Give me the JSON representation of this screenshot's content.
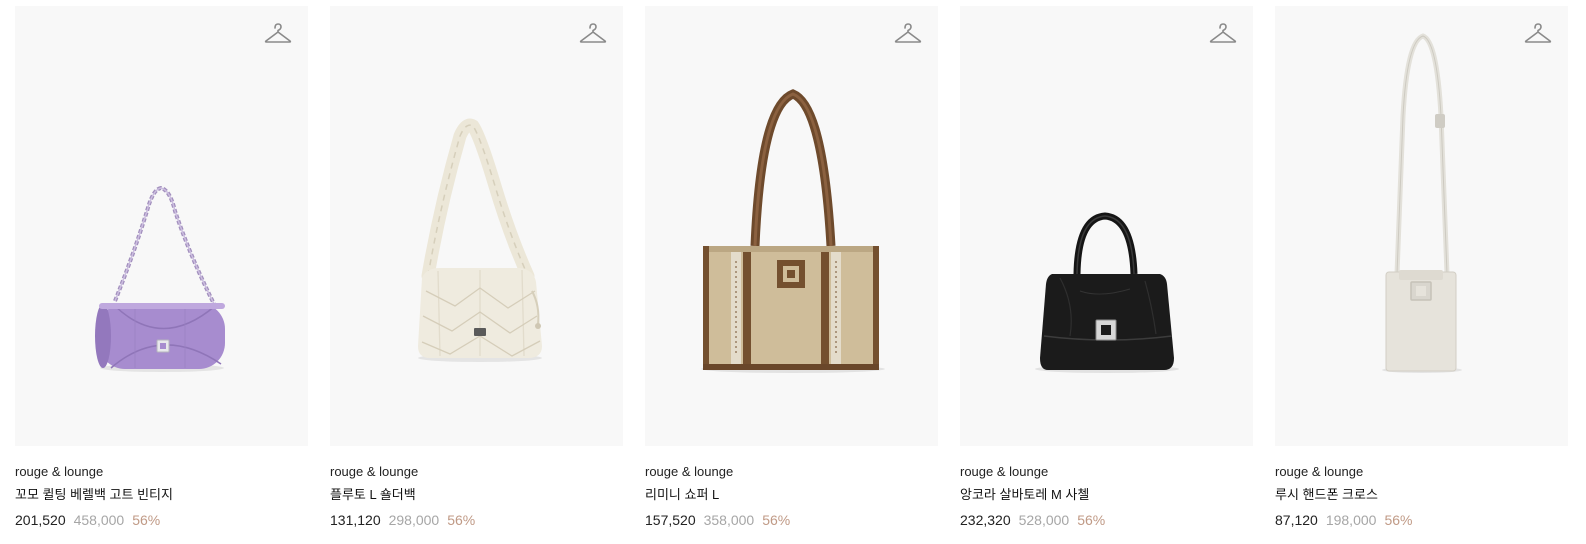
{
  "products": [
    {
      "brand": "rouge & lounge",
      "name": "꼬모 퀼팅 베렐백 고트 빈티지",
      "price": "201,520",
      "original_price": "458,000",
      "discount": "56%",
      "image_desc": "lavender quilted barrel bag with chain strap"
    },
    {
      "brand": "rouge & lounge",
      "name": "플루토 L 숄더백",
      "price": "131,120",
      "original_price": "298,000",
      "discount": "56%",
      "image_desc": "cream ruched shoulder bag"
    },
    {
      "brand": "rouge & lounge",
      "name": "리미니 쇼퍼 L",
      "price": "157,520",
      "original_price": "358,000",
      "discount": "56%",
      "image_desc": "beige canvas shopper with brown leather trim"
    },
    {
      "brand": "rouge & lounge",
      "name": "앙코라 살바토레 M 사첼",
      "price": "232,320",
      "original_price": "528,000",
      "discount": "56%",
      "image_desc": "black leather satchel with top handle"
    },
    {
      "brand": "rouge & lounge",
      "name": "루시 핸드폰 크로스",
      "price": "87,120",
      "original_price": "198,000",
      "discount": "56%",
      "image_desc": "ivory phone crossbody bag with long strap"
    }
  ],
  "colors": {
    "card_bg": "#f8f8f8",
    "price": "#222222",
    "original_price": "#a6a6a6",
    "discount": "#c09a86"
  },
  "icons": {
    "wishlist": "hanger-icon"
  }
}
